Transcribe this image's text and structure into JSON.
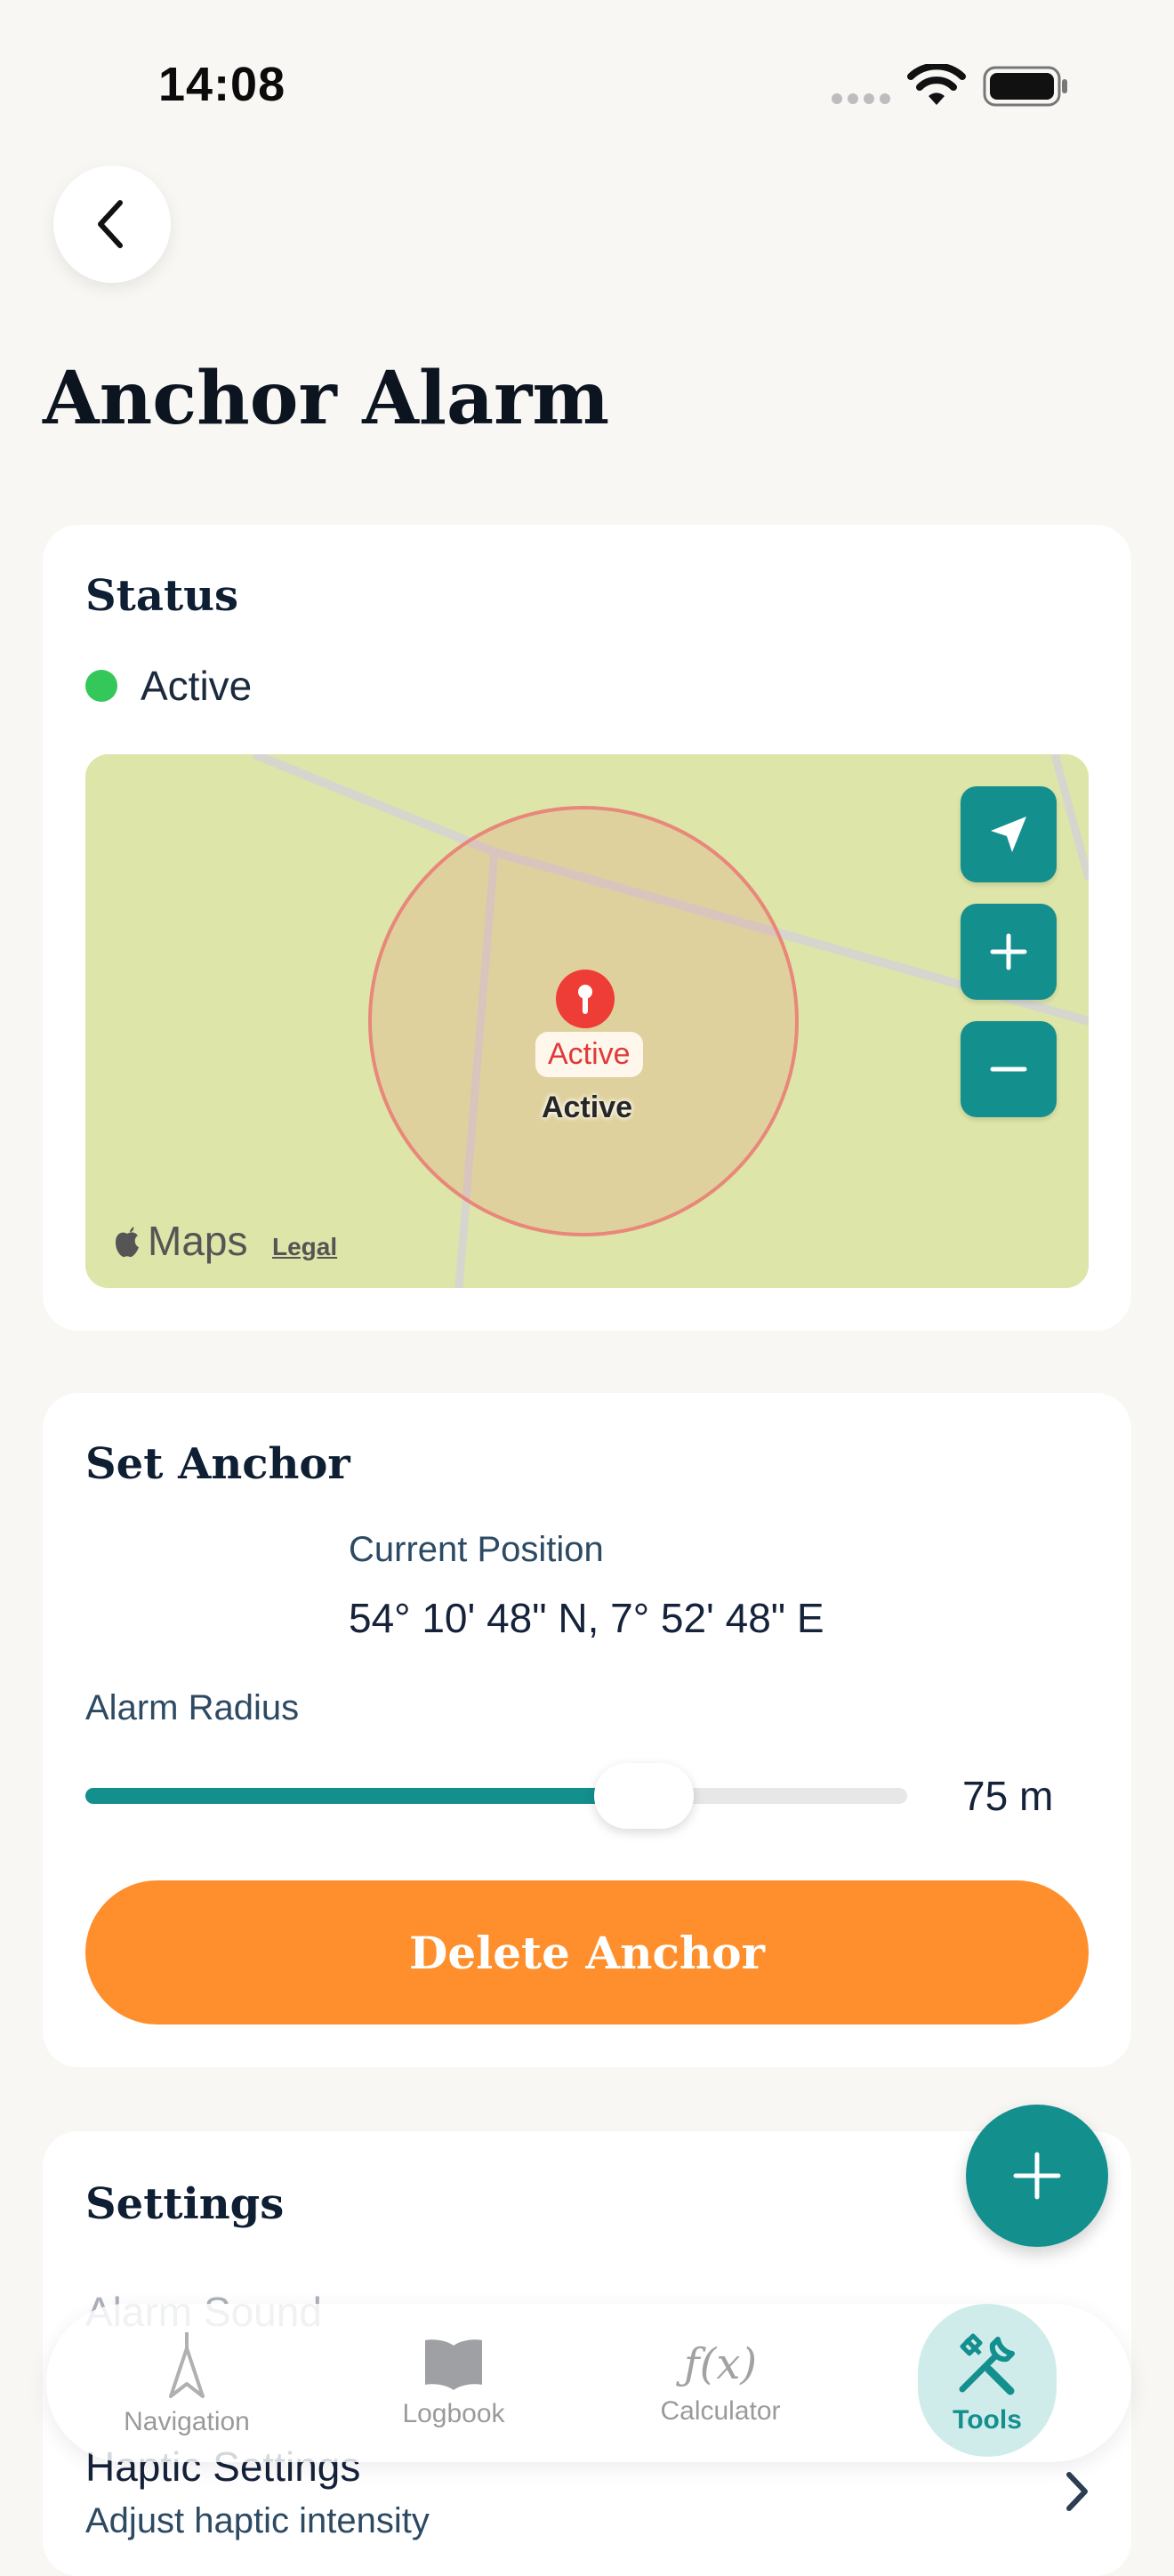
{
  "status_bar": {
    "time": "14:08"
  },
  "header": {
    "title": "Anchor Alarm"
  },
  "status_card": {
    "title": "Status",
    "state": "Active",
    "map": {
      "pin_badge": "Active",
      "pin_label": "Active",
      "brand": "Maps",
      "legal": "Legal"
    }
  },
  "anchor_card": {
    "title": "Set Anchor",
    "position_label": "Current Position",
    "position_value": "54° 10' 48\" N, 7° 52' 48\" E",
    "radius_label": "Alarm Radius",
    "radius_value": "75 m",
    "radius_fraction": 0.68,
    "delete_label": "Delete Anchor"
  },
  "settings_card": {
    "title": "Settings",
    "partial_row": "Alarm Sound",
    "haptic_title": "Haptic Settings",
    "haptic_subtitle": "Adjust haptic intensity"
  },
  "tabbar": {
    "tabs": [
      {
        "label": "Navigation",
        "icon": "navigation-icon"
      },
      {
        "label": "Logbook",
        "icon": "book-icon"
      },
      {
        "label": "Calculator",
        "icon": "function-icon"
      },
      {
        "label": "Tools",
        "icon": "tools-icon",
        "active": true
      }
    ]
  },
  "colors": {
    "accent": "#138f8e",
    "primary_action": "#fe8f2c",
    "status_active": "#34c759",
    "pin": "#e8403b"
  }
}
